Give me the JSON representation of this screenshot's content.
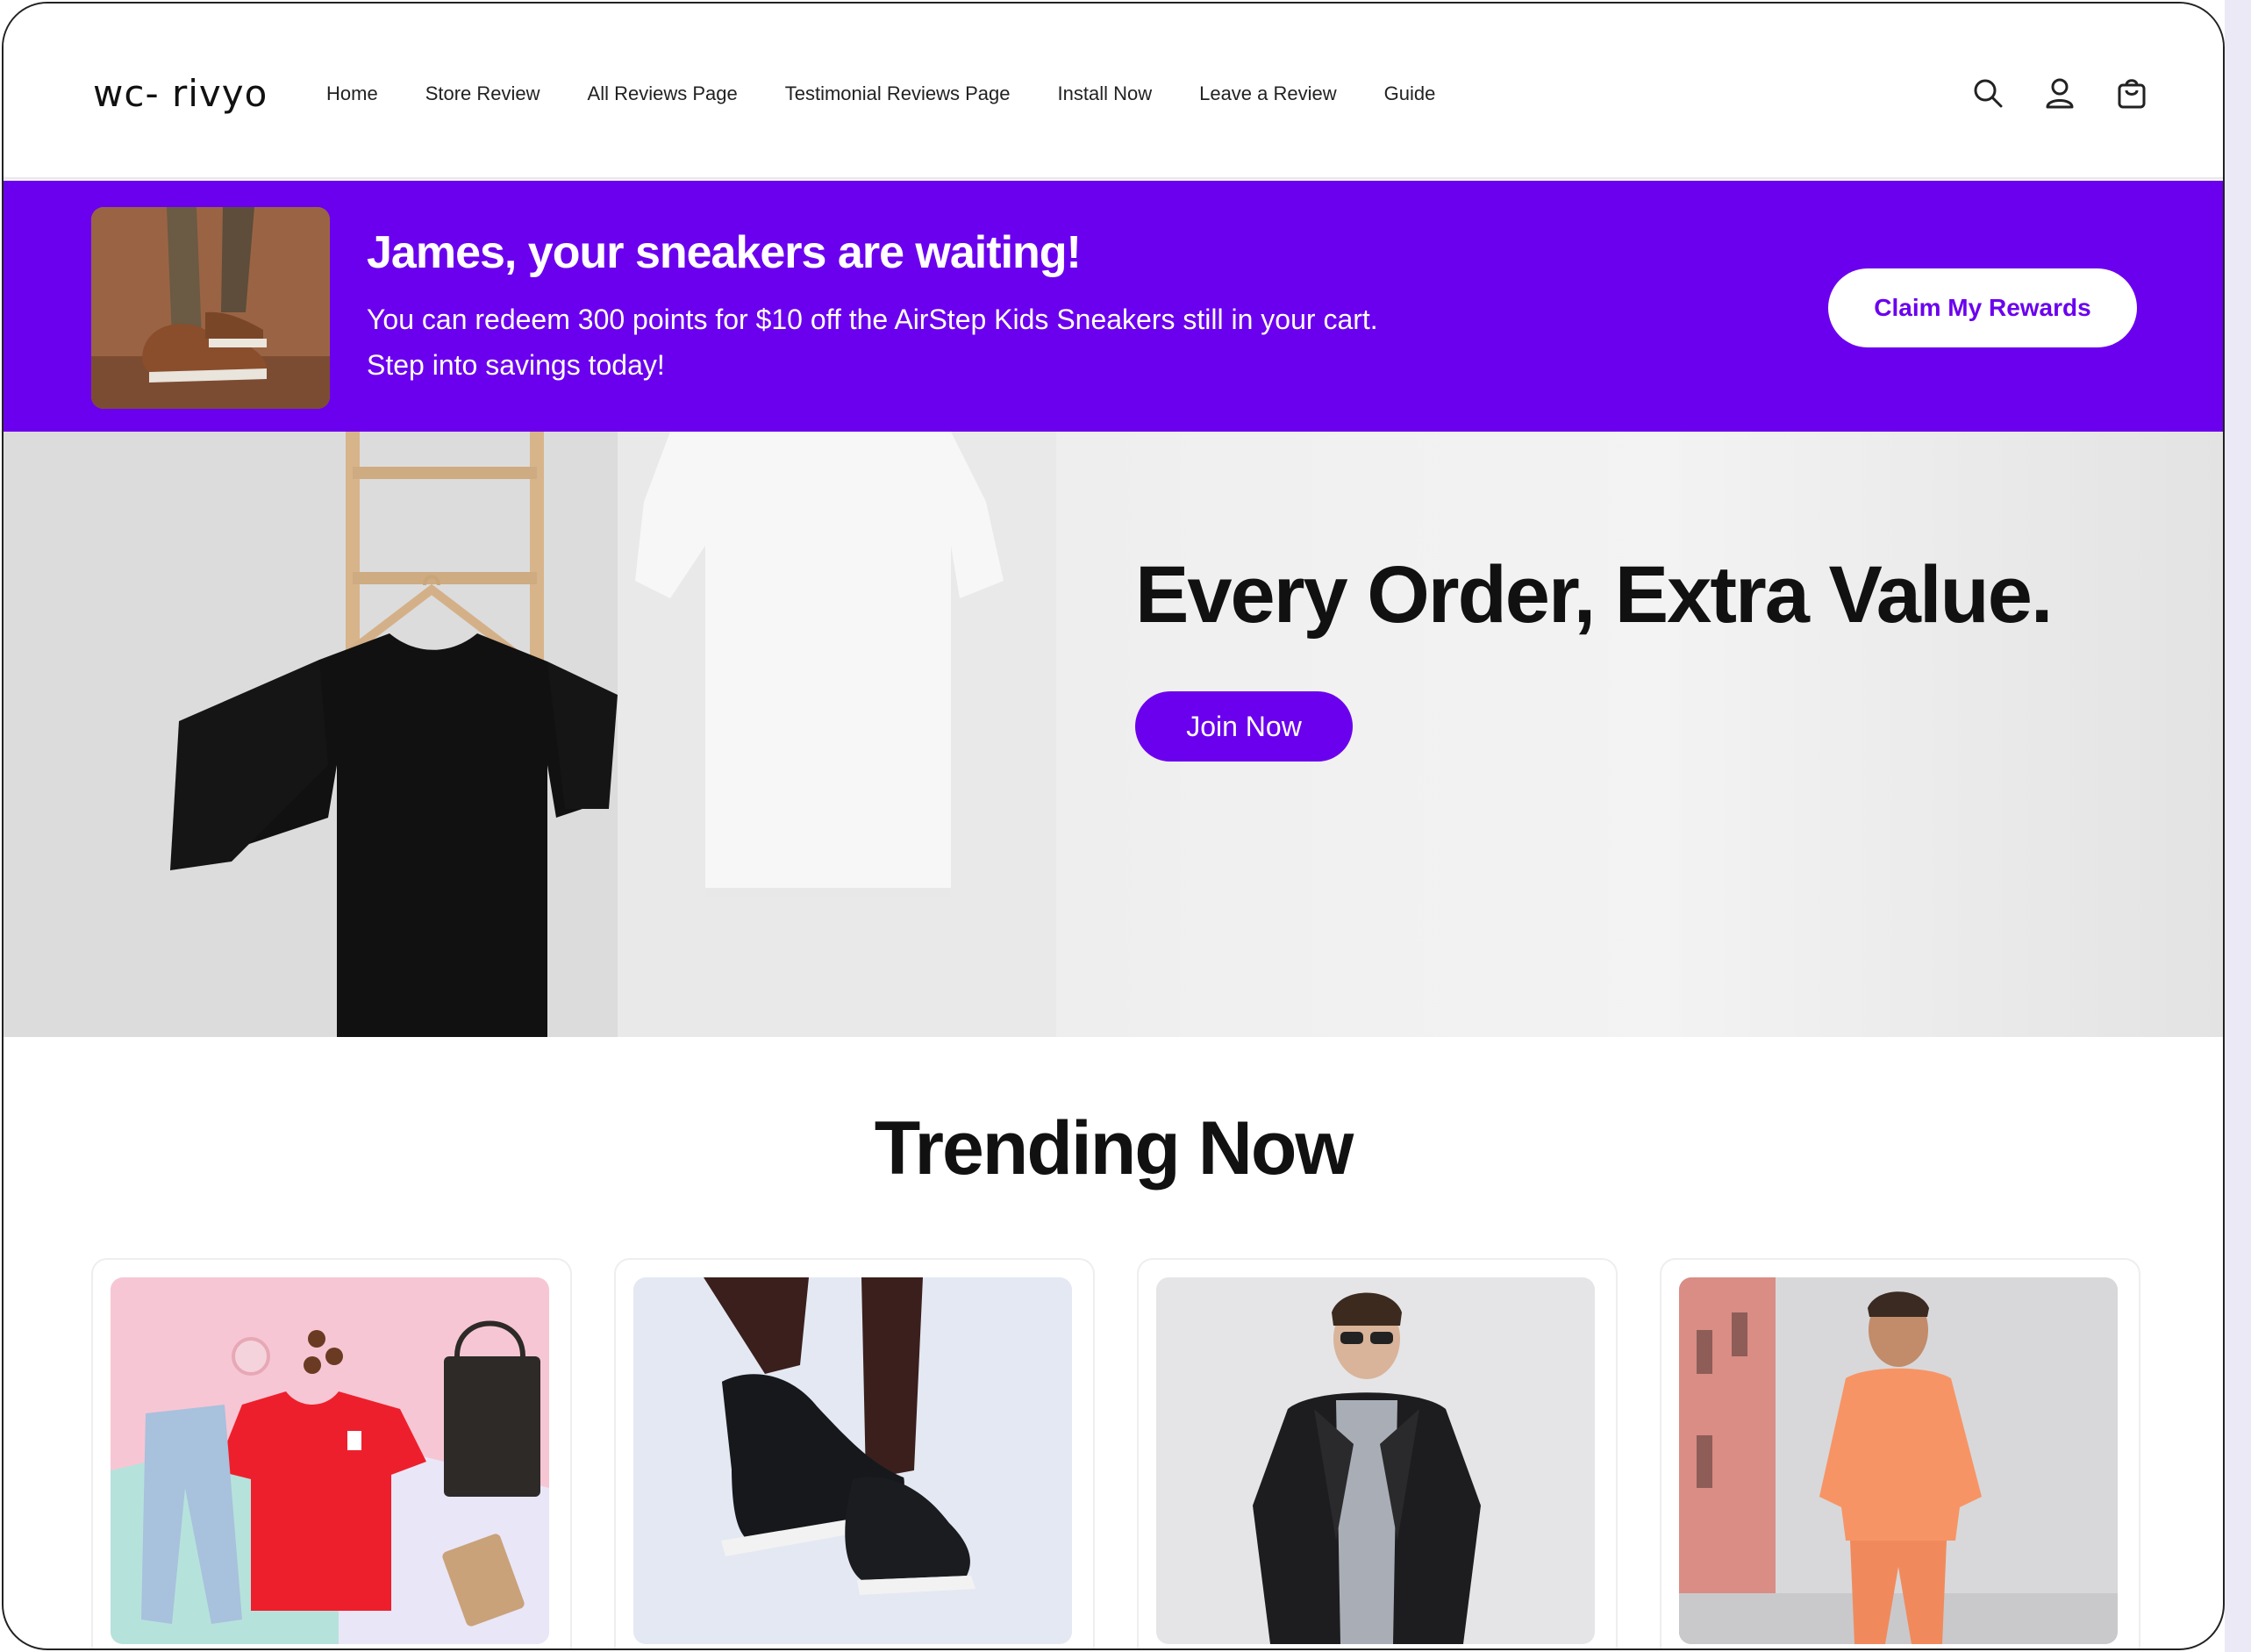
{
  "header": {
    "logo": "wc- rivyo",
    "nav": [
      "Home",
      "Store Review",
      "All Reviews Page",
      "Testimonial Reviews Page",
      "Install Now",
      "Leave a Review",
      "Guide"
    ],
    "icons": [
      "search-icon",
      "account-icon",
      "cart-icon"
    ]
  },
  "banner": {
    "title": "James, your sneakers are waiting!",
    "line1": "You can redeem 300 points for $10 off the AirStep Kids Sneakers still in your cart.",
    "line2": "Step into savings today!",
    "button": "Claim My Rewards",
    "background_color": "#6b00ee"
  },
  "hero": {
    "title": "Every Order, Extra Value.",
    "button": "Join Now",
    "button_color": "#6b00ee"
  },
  "trending": {
    "title": "Trending Now",
    "products": [
      {
        "image": "flat-lay-red-tshirt-jeans-bag"
      },
      {
        "image": "black-sneakers-on-feet"
      },
      {
        "image": "man-leather-jacket-sunglasses"
      },
      {
        "image": "man-orange-tracksuit"
      }
    ]
  }
}
